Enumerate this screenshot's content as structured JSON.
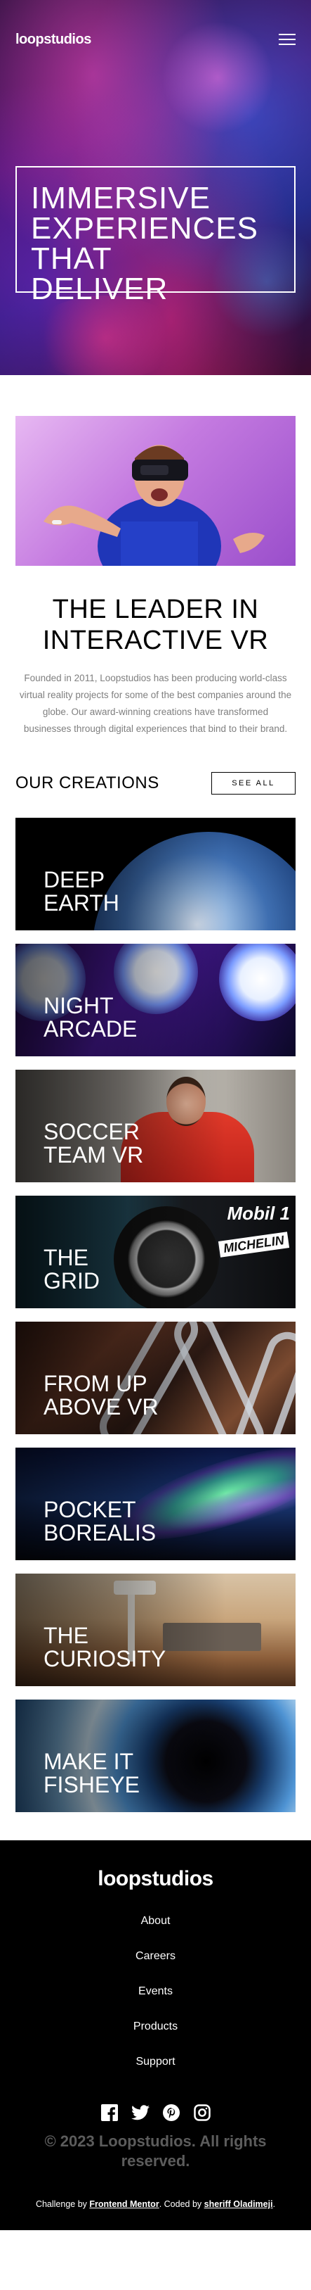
{
  "header": {
    "logo": "loopstudios",
    "menu_icon": "hamburger-menu-icon"
  },
  "hero": {
    "title_lines": [
      "Immersive",
      "experiences",
      "that",
      "deliver"
    ]
  },
  "interactive": {
    "title_lines": [
      "The leader in",
      "interactive VR"
    ],
    "text": "Founded in 2011, Loopstudios has been producing world-class virtual reality projects for some of the best companies around the globe. Our award-winning creations have transformed businesses through digital experiences that bind to their brand."
  },
  "creations": {
    "title": "Our creations",
    "see_all": "SEE ALL",
    "items": [
      {
        "lines": [
          "Deep",
          "earth"
        ]
      },
      {
        "lines": [
          "Night",
          "arcade"
        ]
      },
      {
        "lines": [
          "Soccer",
          "team VR"
        ]
      },
      {
        "lines": [
          "The",
          "grid"
        ]
      },
      {
        "lines": [
          "From up",
          "above VR"
        ]
      },
      {
        "lines": [
          "Pocket",
          "borealis"
        ]
      },
      {
        "lines": [
          "The",
          "curiosity"
        ]
      },
      {
        "lines": [
          "Make it",
          "fisheye"
        ]
      }
    ]
  },
  "footer": {
    "logo": "loopstudios",
    "links": [
      "About",
      "Careers",
      "Events",
      "Products",
      "Support"
    ],
    "socials": [
      "facebook-icon",
      "twitter-icon",
      "pinterest-icon",
      "instagram-icon"
    ],
    "copyright": "© 2023 Loopstudios. All rights reserved.",
    "attribution": {
      "prefix": "Challenge by ",
      "mentor": "Frontend Mentor",
      "middle": ". Coded by ",
      "author": "sheriff Oladimeji",
      "suffix": "."
    }
  },
  "colors": {
    "black": "#000000",
    "white": "#ffffff",
    "dark_gray": "#5c5c5c",
    "text_gray": "#7f7f7f"
  }
}
